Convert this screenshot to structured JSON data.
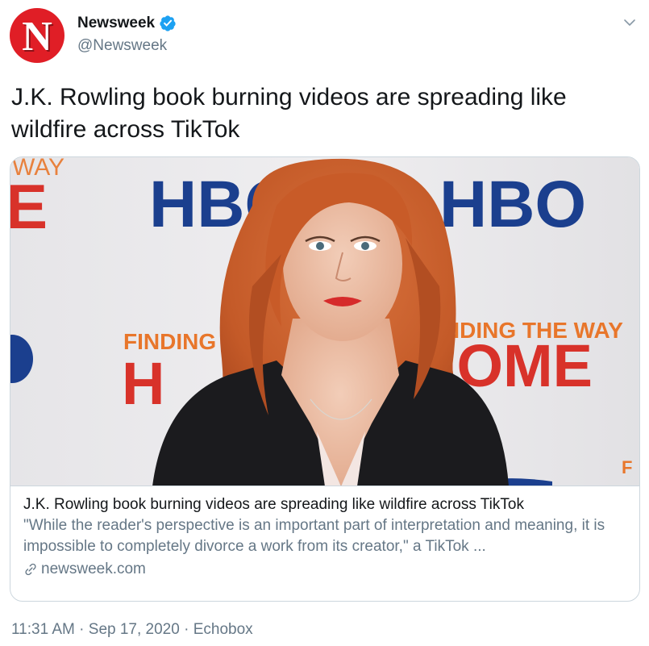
{
  "header": {
    "avatar_letter": "N",
    "display_name": "Newsweek",
    "handle": "@Newsweek",
    "verified": true
  },
  "tweet": {
    "text": "J.K. Rowling book burning videos are spreading like wildfire across TikTok"
  },
  "card": {
    "title": "J.K. Rowling book burning videos are spreading like wildfire across TikTok",
    "description": "\"While the reader's perspective is an important part of interpretation and meaning, it is impossible to completely divorce a work from its creator,\" a TikTok ...",
    "domain": "newsweek.com",
    "backdrop": {
      "logo_text": "HBO",
      "finding_label": "FINDING",
      "finding_full": "FINDING THE WAY",
      "home_label": "HOME",
      "way_label": "WAY"
    }
  },
  "footer": {
    "time": "11:31 AM",
    "separator": " · ",
    "date": "Sep 17, 2020",
    "source": "Echobox"
  },
  "colors": {
    "brand_red": "#e01e26",
    "verified_blue": "#1da1f2",
    "secondary_text": "#657786",
    "border": "#ccd6dd",
    "hbo_blue": "#1b3f8e",
    "finding_orange": "#e8762b"
  }
}
